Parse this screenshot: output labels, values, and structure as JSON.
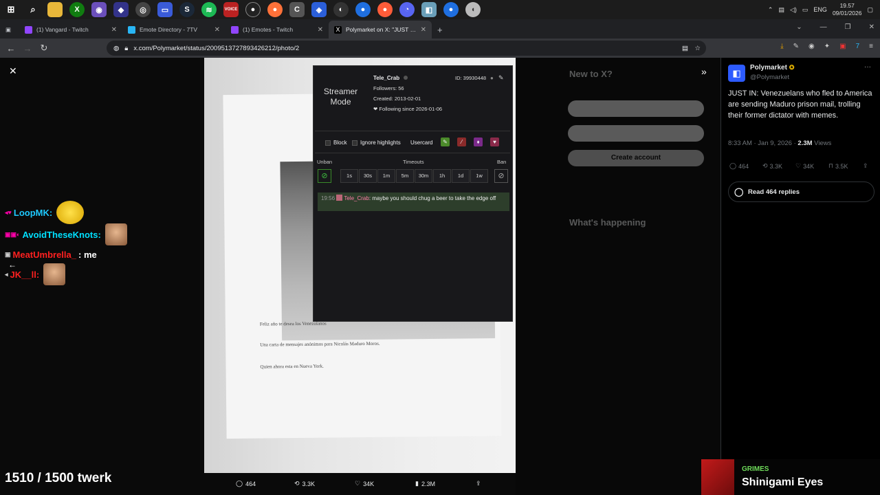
{
  "taskbar": {
    "icons": [
      "windows-icon",
      "search-icon",
      "file-explorer-icon",
      "xbox-icon",
      "game-controller-icon",
      "vpn-icon",
      "maps-icon",
      "app-icon",
      "steam-icon",
      "spotify-icon",
      "voice-app-icon",
      "obs-icon",
      "firefox-icon",
      "browser-icon",
      "app-icon",
      "shield-icon",
      "firefox-icon",
      "firefox-icon",
      "discord-icon",
      "app-icon",
      "firefox-icon",
      "app-icon"
    ],
    "language": "ENG",
    "time": "19.57",
    "date": "09/01/2026"
  },
  "tabs": [
    {
      "title": "(1) Vangard - Twitch",
      "color": "#9146ff"
    },
    {
      "title": "Emote Directory - 7TV",
      "color": "#29b6f6"
    },
    {
      "title": "(1) Emotes - Twitch",
      "color": "#9146ff"
    },
    {
      "title": "Polymarket on X: \"JUST IN: Vene",
      "color": "#ffffff"
    }
  ],
  "url": "x.com/Polymarket/status/2009513727893426212/photo/2",
  "photo_text": {
    "line1": "Feliz año te desea los Venezolanos",
    "line2": "Una carta de mensajes anónimos para Nicolás Maduro Moros.",
    "line3": "Quien ahora esta en Nueva York."
  },
  "usercard": {
    "mode_label": "Streamer Mode",
    "username": "Tele_Crab",
    "id": "ID: 39930448",
    "followers": "Followers: 56",
    "created": "Created: 2013-02-01",
    "following": "❤ Following since 2026-01-06",
    "block": "Block",
    "ignore": "Ignore highlights",
    "usercard": "Usercard",
    "unban": "Unban",
    "timeouts": "Timeouts",
    "ban": "Ban",
    "timeout_options": [
      "1s",
      "30s",
      "1m",
      "5m",
      "30m",
      "1h",
      "1d",
      "1w"
    ],
    "message_time": "19:56",
    "message_user": "Tele_Crab",
    "message_text": ": maybe you should chug a beer to take the edge off"
  },
  "chat": [
    {
      "user": "LoopMK:",
      "color": "#1ec9ff",
      "message": ""
    },
    {
      "user": "AvoidTheseKnots:",
      "color": "#00e0ff",
      "message": ""
    },
    {
      "user": "MeatUmbrella_",
      "color": "#ff2020",
      "message": ": me"
    },
    {
      "user": "JK__ll:",
      "color": "#ff2020",
      "message": ""
    }
  ],
  "tweet": {
    "author": "Polymarket",
    "handle": "@Polymarket",
    "text": "JUST IN: Venezuelans who fled to America are sending Maduro prison mail, trolling their former dictator with memes.",
    "time": "8:33 AM · Jan 9, 2026 · ",
    "views": "2.3M",
    "views_label": " Views",
    "replies": "464",
    "reposts": "3.3K",
    "likes": "34K",
    "bookmarks": "3.5K",
    "read_replies": "Read 464 replies"
  },
  "bottom": {
    "counter": "1510 / 1500 twerk",
    "replies": "464",
    "reposts": "3.3K",
    "likes": "34K",
    "views": "2.3M"
  },
  "song": {
    "artist": "GRIMES",
    "title": "Shinigami Eyes"
  },
  "x_faded": {
    "new_to_x": "New to X?",
    "create_account": "Create account",
    "whats_happening": "What's happening"
  }
}
